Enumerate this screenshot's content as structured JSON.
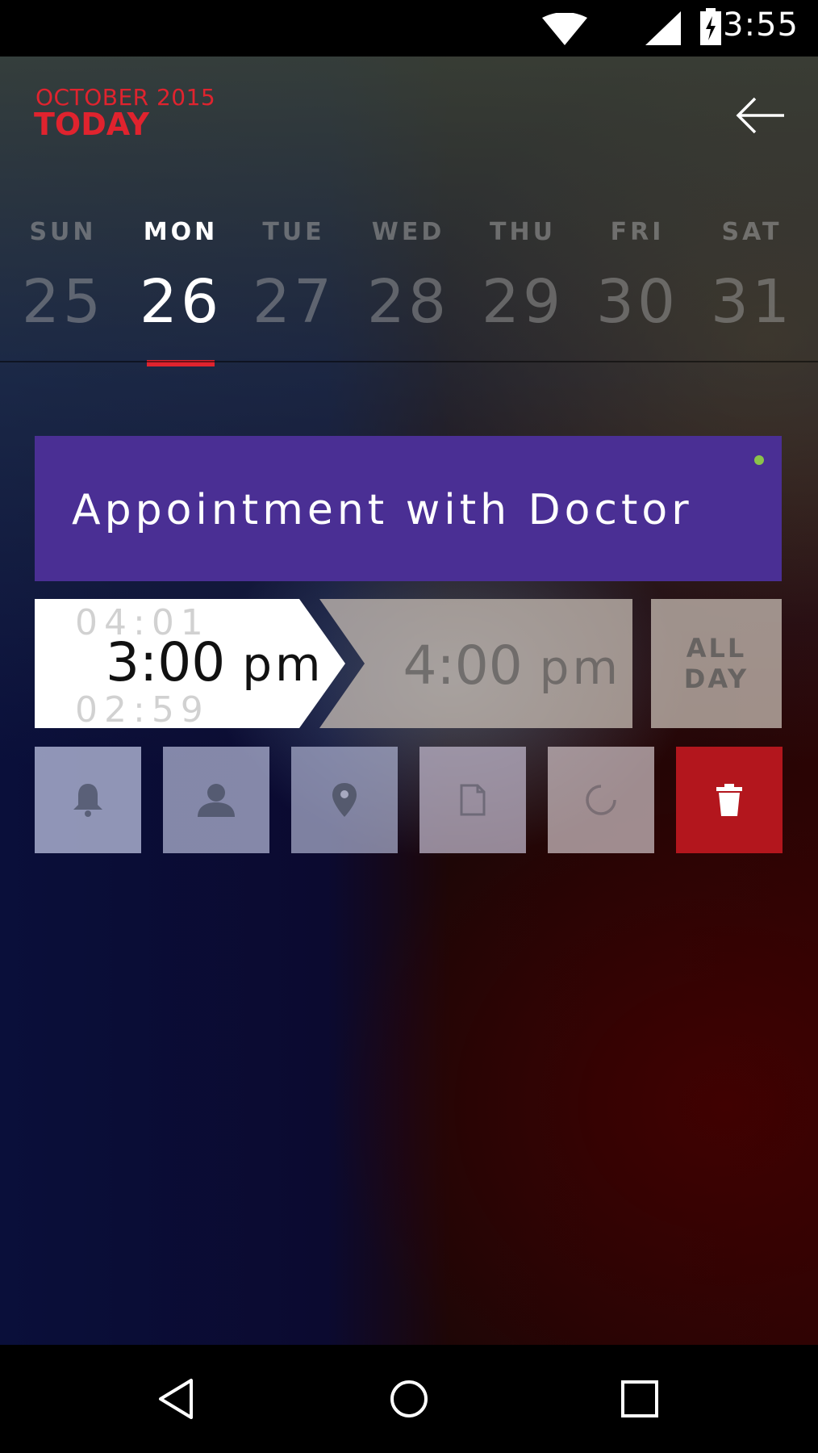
{
  "status_bar": {
    "time": "3:55",
    "icons": [
      "wifi-icon",
      "signal-icon",
      "battery-charging-icon"
    ]
  },
  "header": {
    "month": "OCTOBER 2015",
    "title": "TODAY",
    "back_icon": "arrow-left-icon"
  },
  "week": {
    "days": [
      {
        "name": "SUN",
        "num": "25"
      },
      {
        "name": "MON",
        "num": "26",
        "selected": true
      },
      {
        "name": "TUE",
        "num": "27"
      },
      {
        "name": "WED",
        "num": "28"
      },
      {
        "name": "THU",
        "num": "29"
      },
      {
        "name": "FRI",
        "num": "30"
      },
      {
        "name": "SAT",
        "num": "31"
      }
    ]
  },
  "event": {
    "title": "Appointment with Doctor",
    "color": "#4a2f94",
    "status_color": "#8bc34a"
  },
  "time": {
    "start_prev": "04:01",
    "start_time": "3:00",
    "start_ampm": "pm",
    "start_next": "02:59",
    "end_time": "4:00",
    "end_ampm": "pm",
    "allday_line1": "ALL",
    "allday_line2": "DAY"
  },
  "actions": [
    {
      "icon": "bell-icon"
    },
    {
      "icon": "person-icon"
    },
    {
      "icon": "location-pin-icon"
    },
    {
      "icon": "document-icon"
    },
    {
      "icon": "repeat-circle-icon"
    },
    {
      "icon": "trash-icon",
      "color": "#b3161d"
    }
  ],
  "nav": {
    "icons": [
      "back-triangle-icon",
      "home-circle-icon",
      "recents-square-icon"
    ]
  }
}
